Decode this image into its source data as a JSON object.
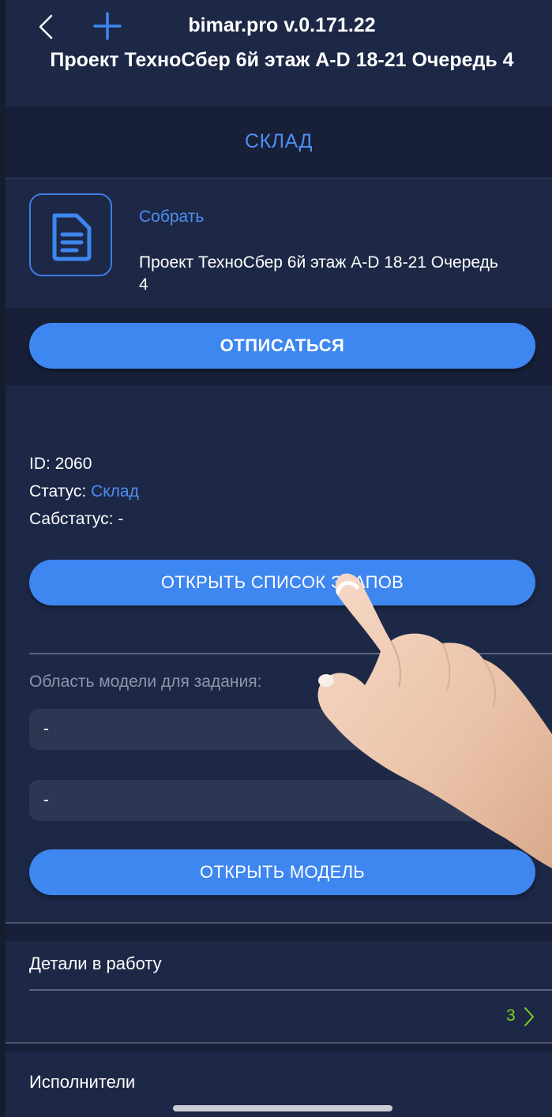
{
  "header": {
    "app_title": "bimar.pro v.0.171.22",
    "project_title": "Проект ТехноСбер 6й этаж A-D 18-21 Очередь 4"
  },
  "section": {
    "title": "СКЛАД"
  },
  "task": {
    "icon": "document-icon",
    "action": "Собрать",
    "description": "Проект ТехноСбер 6й этаж A-D 18-21 Очередь 4"
  },
  "buttons": {
    "unsubscribe": "ОТПИСАТЬСЯ",
    "open_stages": "ОТКРЫТЬ СПИСОК ЭТАПОВ",
    "open_model": "ОТКРЫТЬ МОДЕЛЬ"
  },
  "info": {
    "id_label": "ID: ",
    "id_value": "2060",
    "status_label": "Статус: ",
    "status_value": "Склад",
    "substatus_label": "Сабстатус: ",
    "substatus_value": "-"
  },
  "model_area": {
    "label": "Область модели для задания:",
    "field1_value": "-",
    "field2_value": "-"
  },
  "details": {
    "title": "Детали в работу",
    "count": "3"
  },
  "executors": {
    "title": "Исполнители"
  },
  "colors": {
    "accent": "#3e86f0",
    "background": "#1d2846",
    "count": "#7ed321"
  }
}
